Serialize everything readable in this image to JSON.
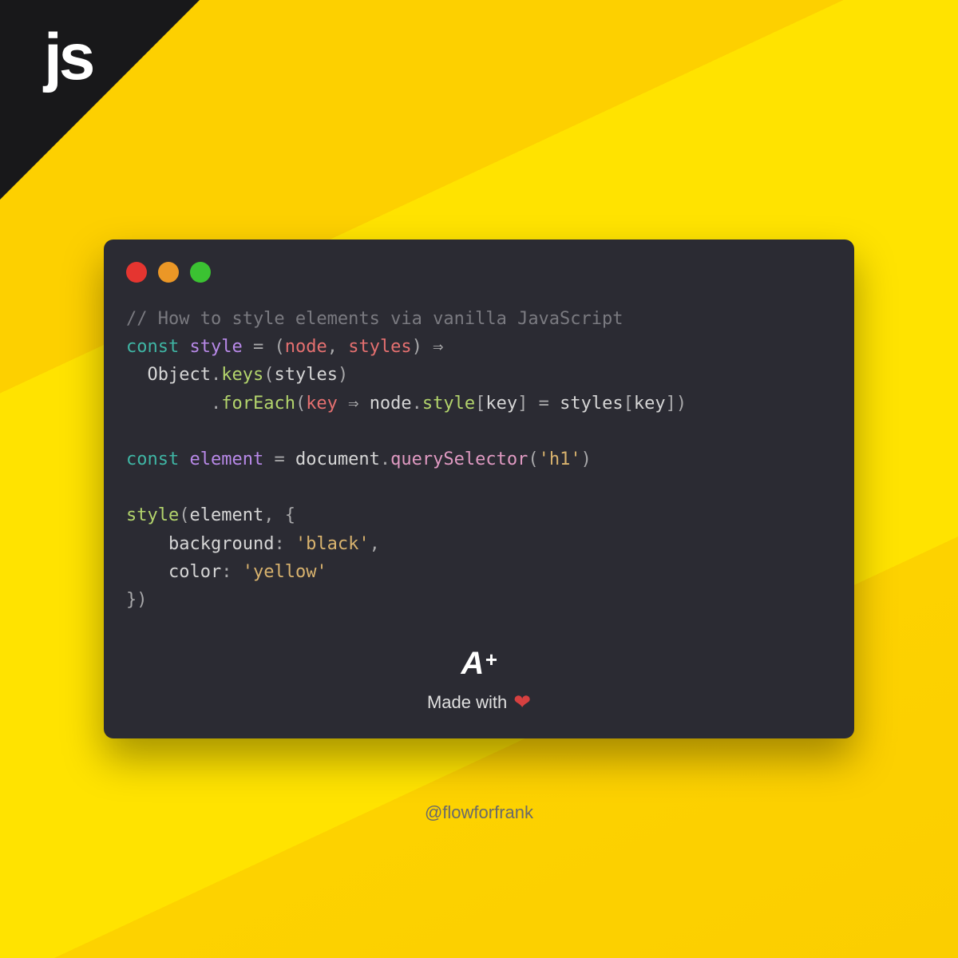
{
  "corner": {
    "label": "js"
  },
  "window": {
    "dots": [
      "red",
      "orange",
      "green"
    ]
  },
  "code": {
    "l1": {
      "comment": "// How to style elements via vanilla JavaScript"
    },
    "l2": {
      "const": "const",
      "name": "style",
      "eq": " = ",
      "lparen": "(",
      "p1": "node",
      "comma": ", ",
      "p2": "styles",
      "rparen": ")",
      "arrow": " ⇒"
    },
    "l3": {
      "indent": "  ",
      "obj": "Object",
      "dot": ".",
      "method": "keys",
      "lparen": "(",
      "arg": "styles",
      "rparen": ")"
    },
    "l4": {
      "indent": "        ",
      "dot": ".",
      "method": "forEach",
      "lparen": "(",
      "p": "key",
      "arrow": " ⇒ ",
      "node": "node",
      "dot2": ".",
      "style": "style",
      "lb": "[",
      "key1": "key",
      "rb": "]",
      "eq": " = ",
      "styles": "styles",
      "lb2": "[",
      "key2": "key",
      "rb2": "]",
      "rparen": ")"
    },
    "l6": {
      "const": "const",
      "name": "element",
      "eq": " = ",
      "doc": "document",
      "dot": ".",
      "method": "querySelector",
      "lparen": "(",
      "str": "'h1'",
      "rparen": ")"
    },
    "l8": {
      "fn": "style",
      "lparen": "(",
      "arg": "element",
      "comma": ", ",
      "brace": "{"
    },
    "l9": {
      "indent": "    ",
      "prop": "background",
      "colon": ": ",
      "val": "'black'",
      "comma": ","
    },
    "l10": {
      "indent": "    ",
      "prop": "color",
      "colon": ": ",
      "val": "'yellow'"
    },
    "l11": {
      "brace": "}",
      "rparen": ")"
    }
  },
  "footer": {
    "logo_a": "A",
    "logo_plus": "+",
    "made_with": "Made with"
  },
  "attribution": "@flowforfrank"
}
